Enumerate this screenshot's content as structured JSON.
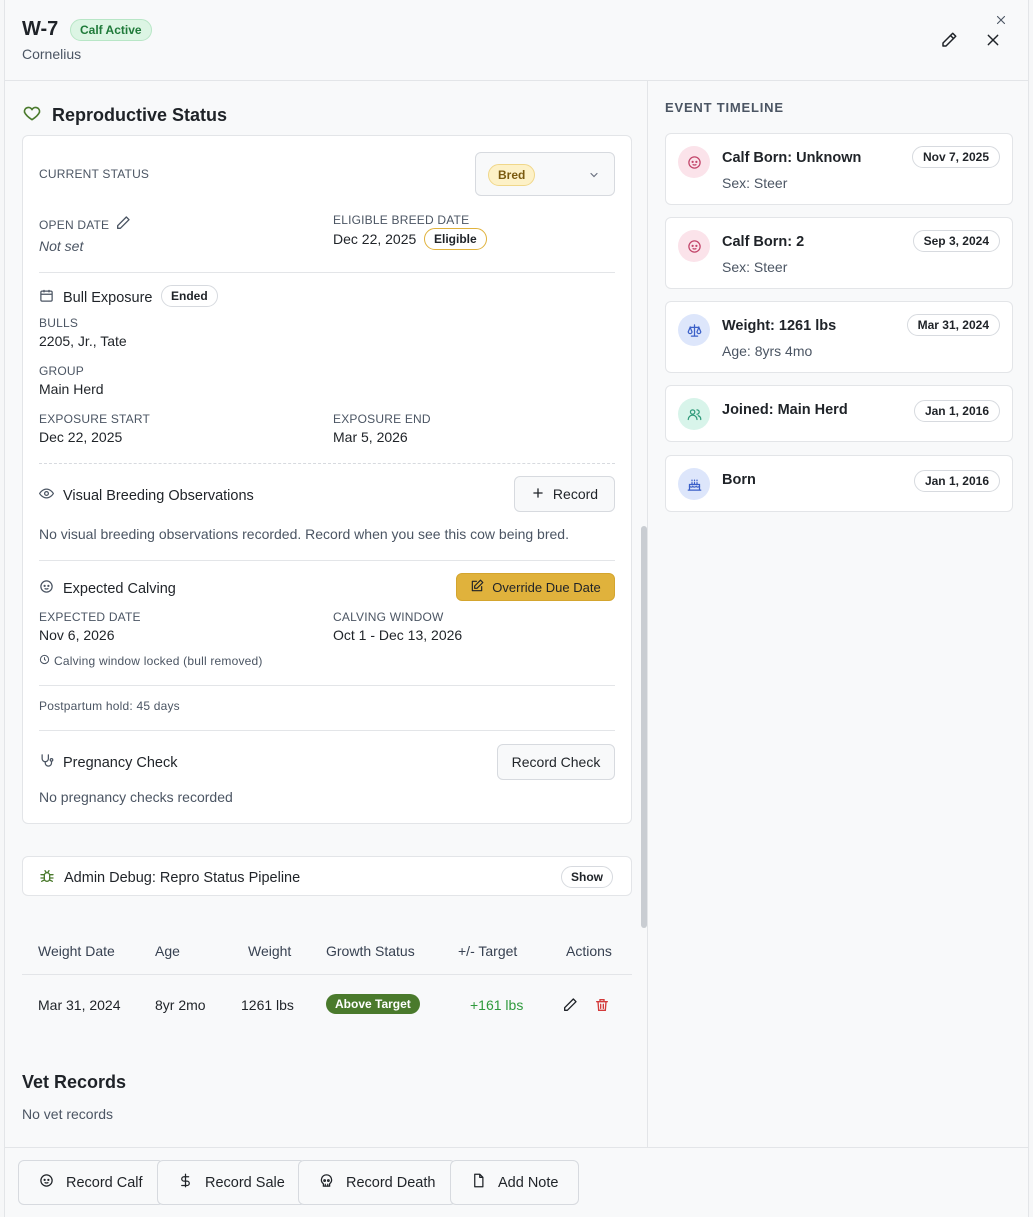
{
  "header": {
    "title": "W-7",
    "badge": "Calf Active",
    "subtitle": "Cornelius"
  },
  "repro": {
    "title": "Reproductive Status",
    "current_status_label": "CURRENT STATUS",
    "current_status_value": "Bred",
    "open_date_label": "OPEN DATE",
    "open_date_value": "Not set",
    "eligible_label": "ELIGIBLE BREED DATE",
    "eligible_value": "Dec 22, 2025",
    "eligible_badge": "Eligible",
    "bull_exposure": {
      "title": "Bull Exposure",
      "badge": "Ended",
      "bulls_label": "BULLS",
      "bulls_value": "2205, Jr., Tate",
      "group_label": "GROUP",
      "group_value": "Main Herd",
      "start_label": "EXPOSURE START",
      "start_value": "Dec 22, 2025",
      "end_label": "EXPOSURE END",
      "end_value": "Mar 5, 2026"
    },
    "observations": {
      "title": "Visual Breeding Observations",
      "button": "Record",
      "empty": "No visual breeding observations recorded. Record when you see this cow being bred."
    },
    "calving": {
      "title": "Expected Calving",
      "override_button": "Override Due Date",
      "expected_label": "EXPECTED DATE",
      "expected_value": "Nov 6, 2026",
      "window_label": "CALVING WINDOW",
      "window_value": "Oct 1 - Dec 13, 2026",
      "locked_note": "Calving window locked (bull removed)",
      "postpartum": "Postpartum hold: 45 days"
    },
    "pregnancy": {
      "title": "Pregnancy Check",
      "button": "Record Check",
      "empty": "No pregnancy checks recorded"
    }
  },
  "debug": {
    "title": "Admin Debug: Repro Status Pipeline",
    "button": "Show"
  },
  "weights": {
    "headers": [
      "Weight Date",
      "Age",
      "Weight",
      "Growth Status",
      "+/- Target",
      "Actions"
    ],
    "rows": [
      {
        "date": "Mar 31, 2024",
        "age": "8yr 2mo",
        "weight": "1261 lbs",
        "status": "Above Target",
        "target": "+161 lbs"
      }
    ]
  },
  "vet": {
    "title": "Vet Records",
    "empty": "No vet records"
  },
  "timeline": {
    "title": "EVENT TIMELINE",
    "events": [
      {
        "title": "Calf Born: Unknown",
        "sub": "Sex: Steer",
        "date": "Nov 7, 2025",
        "icon": "baby-icon"
      },
      {
        "title": "Calf Born: 2",
        "sub": "Sex: Steer",
        "date": "Sep 3, 2024",
        "icon": "baby-icon"
      },
      {
        "title": "Weight: 1261 lbs",
        "sub": "Age: 8yrs 4mo",
        "date": "Mar 31, 2024",
        "icon": "scale-icon"
      },
      {
        "title": "Joined: Main Herd",
        "sub": "",
        "date": "Jan 1, 2016",
        "icon": "users-icon"
      },
      {
        "title": "Born",
        "sub": "",
        "date": "Jan 1, 2016",
        "icon": "cake-icon"
      }
    ]
  },
  "footer": {
    "buttons": [
      "Record Calf",
      "Record Sale",
      "Record Death",
      "Add Note"
    ]
  },
  "colors": {
    "accent_green": "#4a7a2c",
    "warning_yellow": "#e0b23c",
    "bred_badge_bg": "#fdf1c7",
    "delete_red": "#d33a3a"
  }
}
